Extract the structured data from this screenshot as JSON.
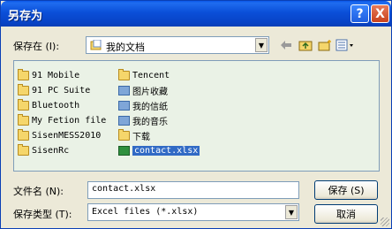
{
  "window": {
    "title": "另存为"
  },
  "titlebar": {
    "help": "?",
    "close": "X"
  },
  "location": {
    "label": "保存在 (I):",
    "value": "我的文档"
  },
  "files": [
    {
      "name": "91 Mobile",
      "kind": "folder"
    },
    {
      "name": "91 PC Suite",
      "kind": "folder"
    },
    {
      "name": "Bluetooth",
      "kind": "folder"
    },
    {
      "name": "My Fetion file",
      "kind": "folder"
    },
    {
      "name": "SisenMESS2010",
      "kind": "folder"
    },
    {
      "name": "SisenRc",
      "kind": "folder"
    },
    {
      "name": "Tencent",
      "kind": "folder"
    },
    {
      "name": "图片收藏",
      "kind": "special"
    },
    {
      "name": "我的信纸",
      "kind": "special"
    },
    {
      "name": "我的音乐",
      "kind": "special"
    },
    {
      "name": "下载",
      "kind": "folder"
    },
    {
      "name": "contact.xlsx",
      "kind": "xlsx",
      "selected": true
    }
  ],
  "filename": {
    "label": "文件名 (N):",
    "value": "contact.xlsx"
  },
  "filetype": {
    "label": "保存类型 (T):",
    "value": "Excel files (*.xlsx)"
  },
  "buttons": {
    "save": "保存 (S)",
    "cancel": "取消"
  }
}
